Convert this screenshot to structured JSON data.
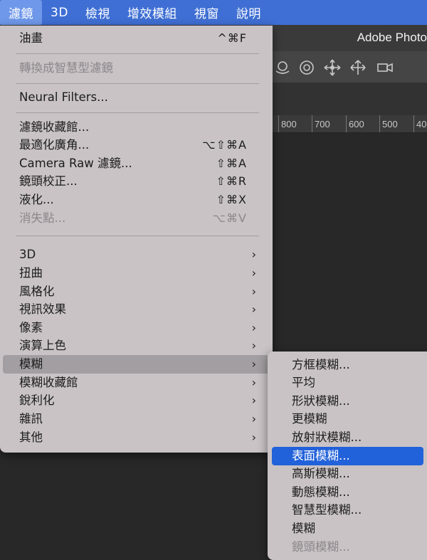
{
  "menubar": {
    "items": [
      {
        "label": "濾鏡",
        "active": true
      },
      {
        "label": "3D",
        "active": false
      },
      {
        "label": "檢視",
        "active": false
      },
      {
        "label": "增效模組",
        "active": false
      },
      {
        "label": "視窗",
        "active": false
      },
      {
        "label": "說明",
        "active": false
      }
    ]
  },
  "app": {
    "title": "Adobe Photo"
  },
  "ruler": {
    "labels": [
      "800",
      "700",
      "600",
      "500",
      "40"
    ]
  },
  "toolbar_icons": [
    "orbit-3d-icon",
    "roll-3d-icon",
    "pan-3d-icon",
    "slide-3d-icon",
    "camera-scale-icon"
  ],
  "filter_menu": {
    "items": [
      {
        "label": "油畫",
        "shortcut": "^⌘F",
        "disabled": false
      },
      {
        "label": "轉換成智慧型濾鏡",
        "shortcut": "",
        "disabled": true
      },
      {
        "label": "Neural Filters...",
        "shortcut": "",
        "disabled": false
      },
      {
        "label": "濾鏡收藏館...",
        "shortcut": "",
        "disabled": false
      },
      {
        "label": "最適化廣角...",
        "shortcut": "⌥⇧⌘A",
        "disabled": false
      },
      {
        "label": "Camera Raw 濾鏡...",
        "shortcut": "⇧⌘A",
        "disabled": false
      },
      {
        "label": "鏡頭校正...",
        "shortcut": "⇧⌘R",
        "disabled": false
      },
      {
        "label": "液化...",
        "shortcut": "⇧⌘X",
        "disabled": false
      },
      {
        "label": "消失點...",
        "shortcut": "⌥⌘V",
        "disabled": true
      },
      {
        "label": "3D",
        "submenu": true
      },
      {
        "label": "扭曲",
        "submenu": true
      },
      {
        "label": "風格化",
        "submenu": true
      },
      {
        "label": "視訊效果",
        "submenu": true
      },
      {
        "label": "像素",
        "submenu": true
      },
      {
        "label": "演算上色",
        "submenu": true
      },
      {
        "label": "模糊",
        "submenu": true,
        "highlighted": true
      },
      {
        "label": "模糊收藏館",
        "submenu": true
      },
      {
        "label": "銳利化",
        "submenu": true
      },
      {
        "label": "雜訊",
        "submenu": true
      },
      {
        "label": "其他",
        "submenu": true
      }
    ],
    "chevron": "›"
  },
  "blur_submenu": {
    "items": [
      {
        "label": "方框模糊...",
        "selected": false,
        "disabled": false
      },
      {
        "label": "平均",
        "selected": false,
        "disabled": false
      },
      {
        "label": "形狀模糊...",
        "selected": false,
        "disabled": false
      },
      {
        "label": "更模糊",
        "selected": false,
        "disabled": false
      },
      {
        "label": "放射狀模糊...",
        "selected": false,
        "disabled": false
      },
      {
        "label": "表面模糊...",
        "selected": true,
        "disabled": false
      },
      {
        "label": "高斯模糊...",
        "selected": false,
        "disabled": false
      },
      {
        "label": "動態模糊...",
        "selected": false,
        "disabled": false
      },
      {
        "label": "智慧型模糊...",
        "selected": false,
        "disabled": false
      },
      {
        "label": "模糊",
        "selected": false,
        "disabled": false
      },
      {
        "label": "鏡頭模糊...",
        "selected": false,
        "disabled": true
      }
    ]
  },
  "colors": {
    "menubar_bg": "#3f6fd4",
    "menu_bg": "#c9c3c6",
    "selection": "#2161d9",
    "highlight": "#a29ea1"
  }
}
